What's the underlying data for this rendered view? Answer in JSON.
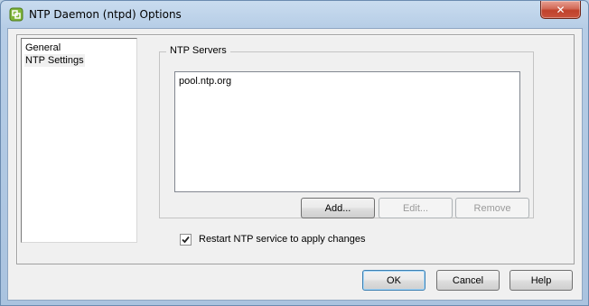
{
  "window": {
    "title": "NTP Daemon (ntpd) Options",
    "close_label": "✕"
  },
  "nav": {
    "items": [
      {
        "label": "General",
        "selected": false
      },
      {
        "label": "NTP Settings",
        "selected": true
      }
    ]
  },
  "ntp_servers": {
    "group_label": "NTP Servers",
    "servers": [
      "pool.ntp.org"
    ],
    "add_label": "Add...",
    "edit_label": "Edit...",
    "remove_label": "Remove"
  },
  "restart": {
    "label": "Restart NTP service to apply changes",
    "checked": true
  },
  "footer": {
    "ok_label": "OK",
    "cancel_label": "Cancel",
    "help_label": "Help"
  }
}
